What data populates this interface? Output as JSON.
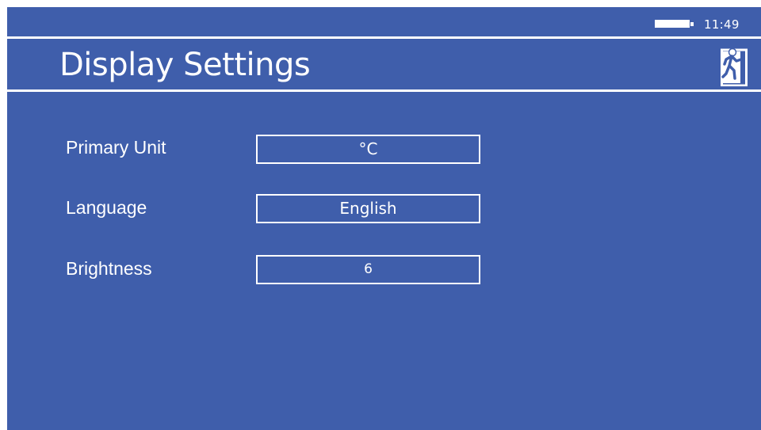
{
  "status_bar": {
    "clock": "11:49",
    "battery_icon": "battery-full-icon"
  },
  "header": {
    "title": "Display Settings",
    "exit_icon": "exit-icon"
  },
  "settings": [
    {
      "label": "Primary Unit",
      "value": "°C"
    },
    {
      "label": "Language",
      "value": "English"
    },
    {
      "label": "Brightness",
      "value": "6"
    }
  ],
  "colors": {
    "background": "#3f5eab",
    "foreground": "#ffffff"
  }
}
